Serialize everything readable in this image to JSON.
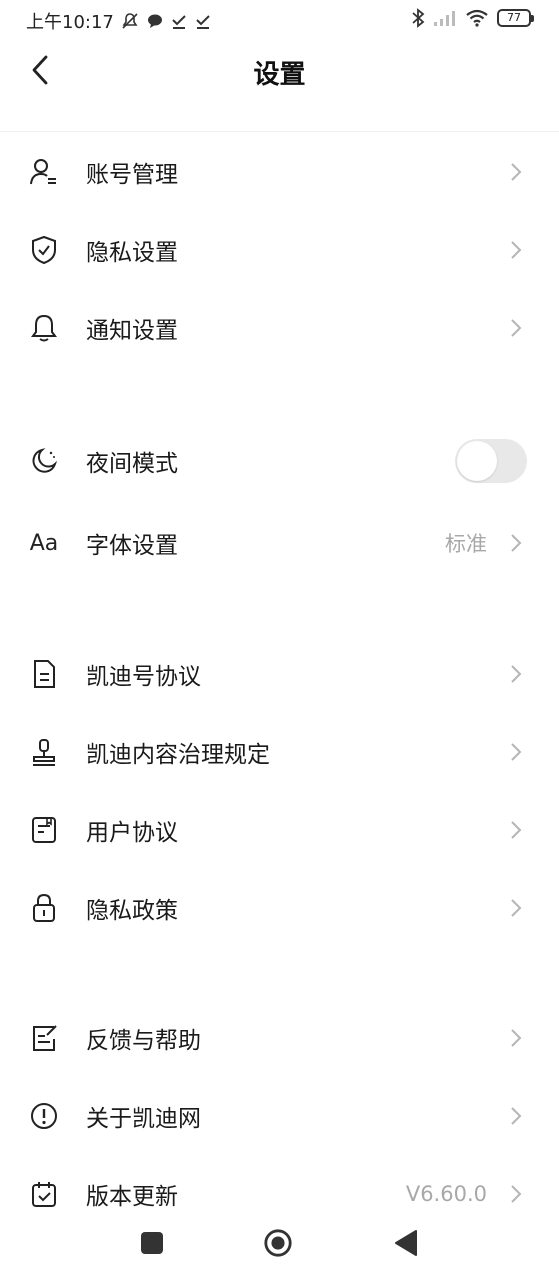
{
  "status_bar": {
    "time": "上午10:17",
    "battery": "77"
  },
  "header": {
    "title": "设置"
  },
  "groups": [
    {
      "items": [
        {
          "label": "账号管理",
          "icon": "user-icon"
        },
        {
          "label": "隐私设置",
          "icon": "shield-icon"
        },
        {
          "label": "通知设置",
          "icon": "bell-icon"
        }
      ]
    },
    {
      "items": [
        {
          "label": "夜间模式",
          "icon": "moon-icon",
          "toggle": false
        },
        {
          "label": "字体设置",
          "icon": "font-size-icon",
          "value": "标准",
          "icon_text": "Aa"
        }
      ]
    },
    {
      "items": [
        {
          "label": "凯迪号协议",
          "icon": "document-icon"
        },
        {
          "label": "凯迪内容治理规定",
          "icon": "stamp-icon"
        },
        {
          "label": "用户协议",
          "icon": "agreement-icon"
        },
        {
          "label": "隐私政策",
          "icon": "lock-icon"
        }
      ]
    },
    {
      "items": [
        {
          "label": "反馈与帮助",
          "icon": "feedback-icon"
        },
        {
          "label": "关于凯迪网",
          "icon": "info-icon"
        },
        {
          "label": "版本更新",
          "icon": "calendar-check-icon",
          "value": "V6.60.0"
        }
      ]
    }
  ],
  "colors": {
    "background": "#ffffff",
    "text": "#1a1a1a",
    "secondary_text": "#a8a8a8",
    "toggle_off": "#e8e8e8"
  }
}
